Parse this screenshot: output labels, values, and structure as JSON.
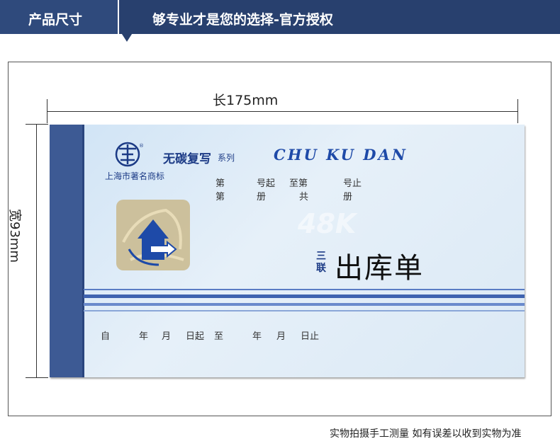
{
  "header": {
    "section_label": "产品尺寸",
    "slogan": "够专业才是您的选择-官方授权"
  },
  "dimensions": {
    "length": "长175mm",
    "width": "宽93mm"
  },
  "product": {
    "brand_name": "无碳复写",
    "series": "系列",
    "trademark": "上海市著名商标",
    "pinyin_title": "CHU KU DAN",
    "format": "48K",
    "copies": "三联",
    "title": "出库单",
    "row1": [
      "第",
      "号起",
      "至第",
      "号止"
    ],
    "row2": [
      "第",
      "册",
      "共",
      "册"
    ],
    "date_row": [
      "自",
      "年",
      "月",
      "日起",
      "至",
      "年",
      "月",
      "日止"
    ]
  },
  "footer_note": "实物拍摄手工测量 如有误差以收到实物为准",
  "colors": {
    "header_bg": "#28406e",
    "book_blue": "#3d5a94",
    "print_blue": "#1c3b86"
  }
}
